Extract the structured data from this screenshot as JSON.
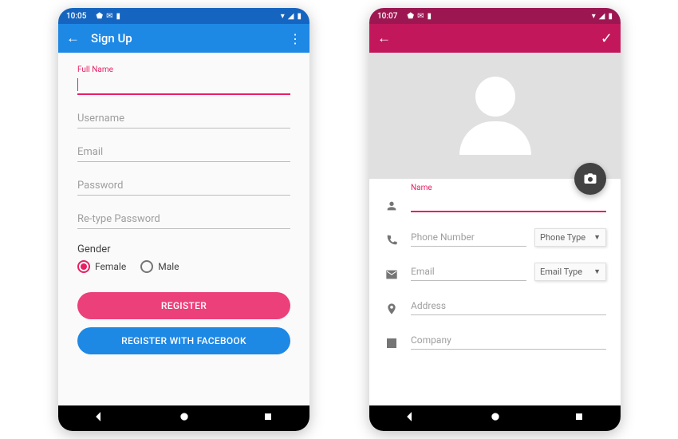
{
  "left": {
    "status": {
      "time": "10:05"
    },
    "appbar": {
      "title": "Sign Up"
    },
    "fields": {
      "fullname_label": "Full Name",
      "username_ph": "Username",
      "email_ph": "Email",
      "password_ph": "Password",
      "retype_ph": "Re-type Password"
    },
    "gender": {
      "label": "Gender",
      "female": "Female",
      "male": "Male"
    },
    "buttons": {
      "register": "REGISTER",
      "register_fb": "REGISTER WITH FACEBOOK"
    }
  },
  "right": {
    "status": {
      "time": "10:07"
    },
    "fields": {
      "name_label": "Name",
      "phone_ph": "Phone Number",
      "phone_type": "Phone Type",
      "email_ph": "Email",
      "email_type": "Email Type",
      "address_ph": "Address",
      "company_ph": "Company"
    }
  }
}
